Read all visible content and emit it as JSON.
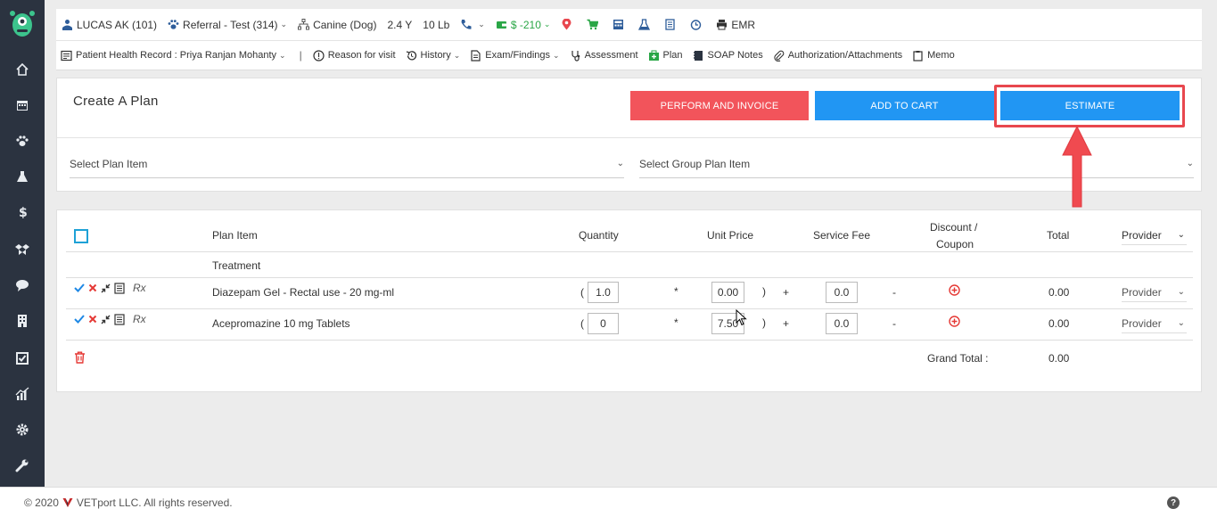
{
  "header": {
    "patient": "LUCAS AK (101)",
    "referral": "Referral - Test (314)",
    "species": "Canine (Dog)",
    "age": "2.4 Y",
    "weight": "10 Lb",
    "balance": "$ -210",
    "emr_label": "EMR"
  },
  "subnav": {
    "record": "Patient Health Record : Priya Ranjan Mohanty",
    "separator": "|",
    "reason": "Reason for visit",
    "history": "History",
    "exam": "Exam/Findings",
    "assessment": "Assessment",
    "plan": "Plan",
    "soap": "SOAP Notes",
    "authorization": "Authorization/Attachments",
    "memo": "Memo"
  },
  "plan_panel": {
    "title": "Create A Plan",
    "perform_label": "PERFORM AND INVOICE",
    "cart_label": "ADD TO CART",
    "estimate_label": "ESTIMATE",
    "select_plan": "Select Plan Item",
    "select_group": "Select Group Plan Item"
  },
  "table": {
    "headers": {
      "plan_item": "Plan Item",
      "quantity": "Quantity",
      "unit_price": "Unit Price",
      "service_fee": "Service Fee",
      "discount_line1": "Discount /",
      "discount_line2": "Coupon",
      "total": "Total",
      "provider": "Provider"
    },
    "section": "Treatment",
    "rows": [
      {
        "rx": "Rx",
        "name": "Diazepam Gel - Rectal use - 20 mg-ml",
        "open_paren": "(",
        "quantity": "1.0",
        "times": "*",
        "unit_price": "0.00",
        "close_paren": ")",
        "plus": "+",
        "service_fee": "0.0",
        "minus": "-",
        "total": "0.00",
        "provider": "Provider"
      },
      {
        "rx": "Rx",
        "name": "Acepromazine 10 mg Tablets",
        "open_paren": "(",
        "quantity": "0",
        "times": "*",
        "unit_price": "7.50",
        "close_paren": ")",
        "plus": "+",
        "service_fee": "0.0",
        "minus": "-",
        "total": "0.00",
        "provider": "Provider"
      }
    ],
    "grand_total_label": "Grand Total :",
    "grand_total": "0.00"
  },
  "footer": {
    "copyright_year": "© 2020",
    "company": "VETport LLC. All rights reserved.",
    "help": "?"
  },
  "colors": {
    "sidebar": "#2b3340",
    "primary_blue": "#2196f3",
    "red_button": "#f2545b",
    "annotation_red": "#e8474e",
    "accent_green": "#2aa646"
  }
}
